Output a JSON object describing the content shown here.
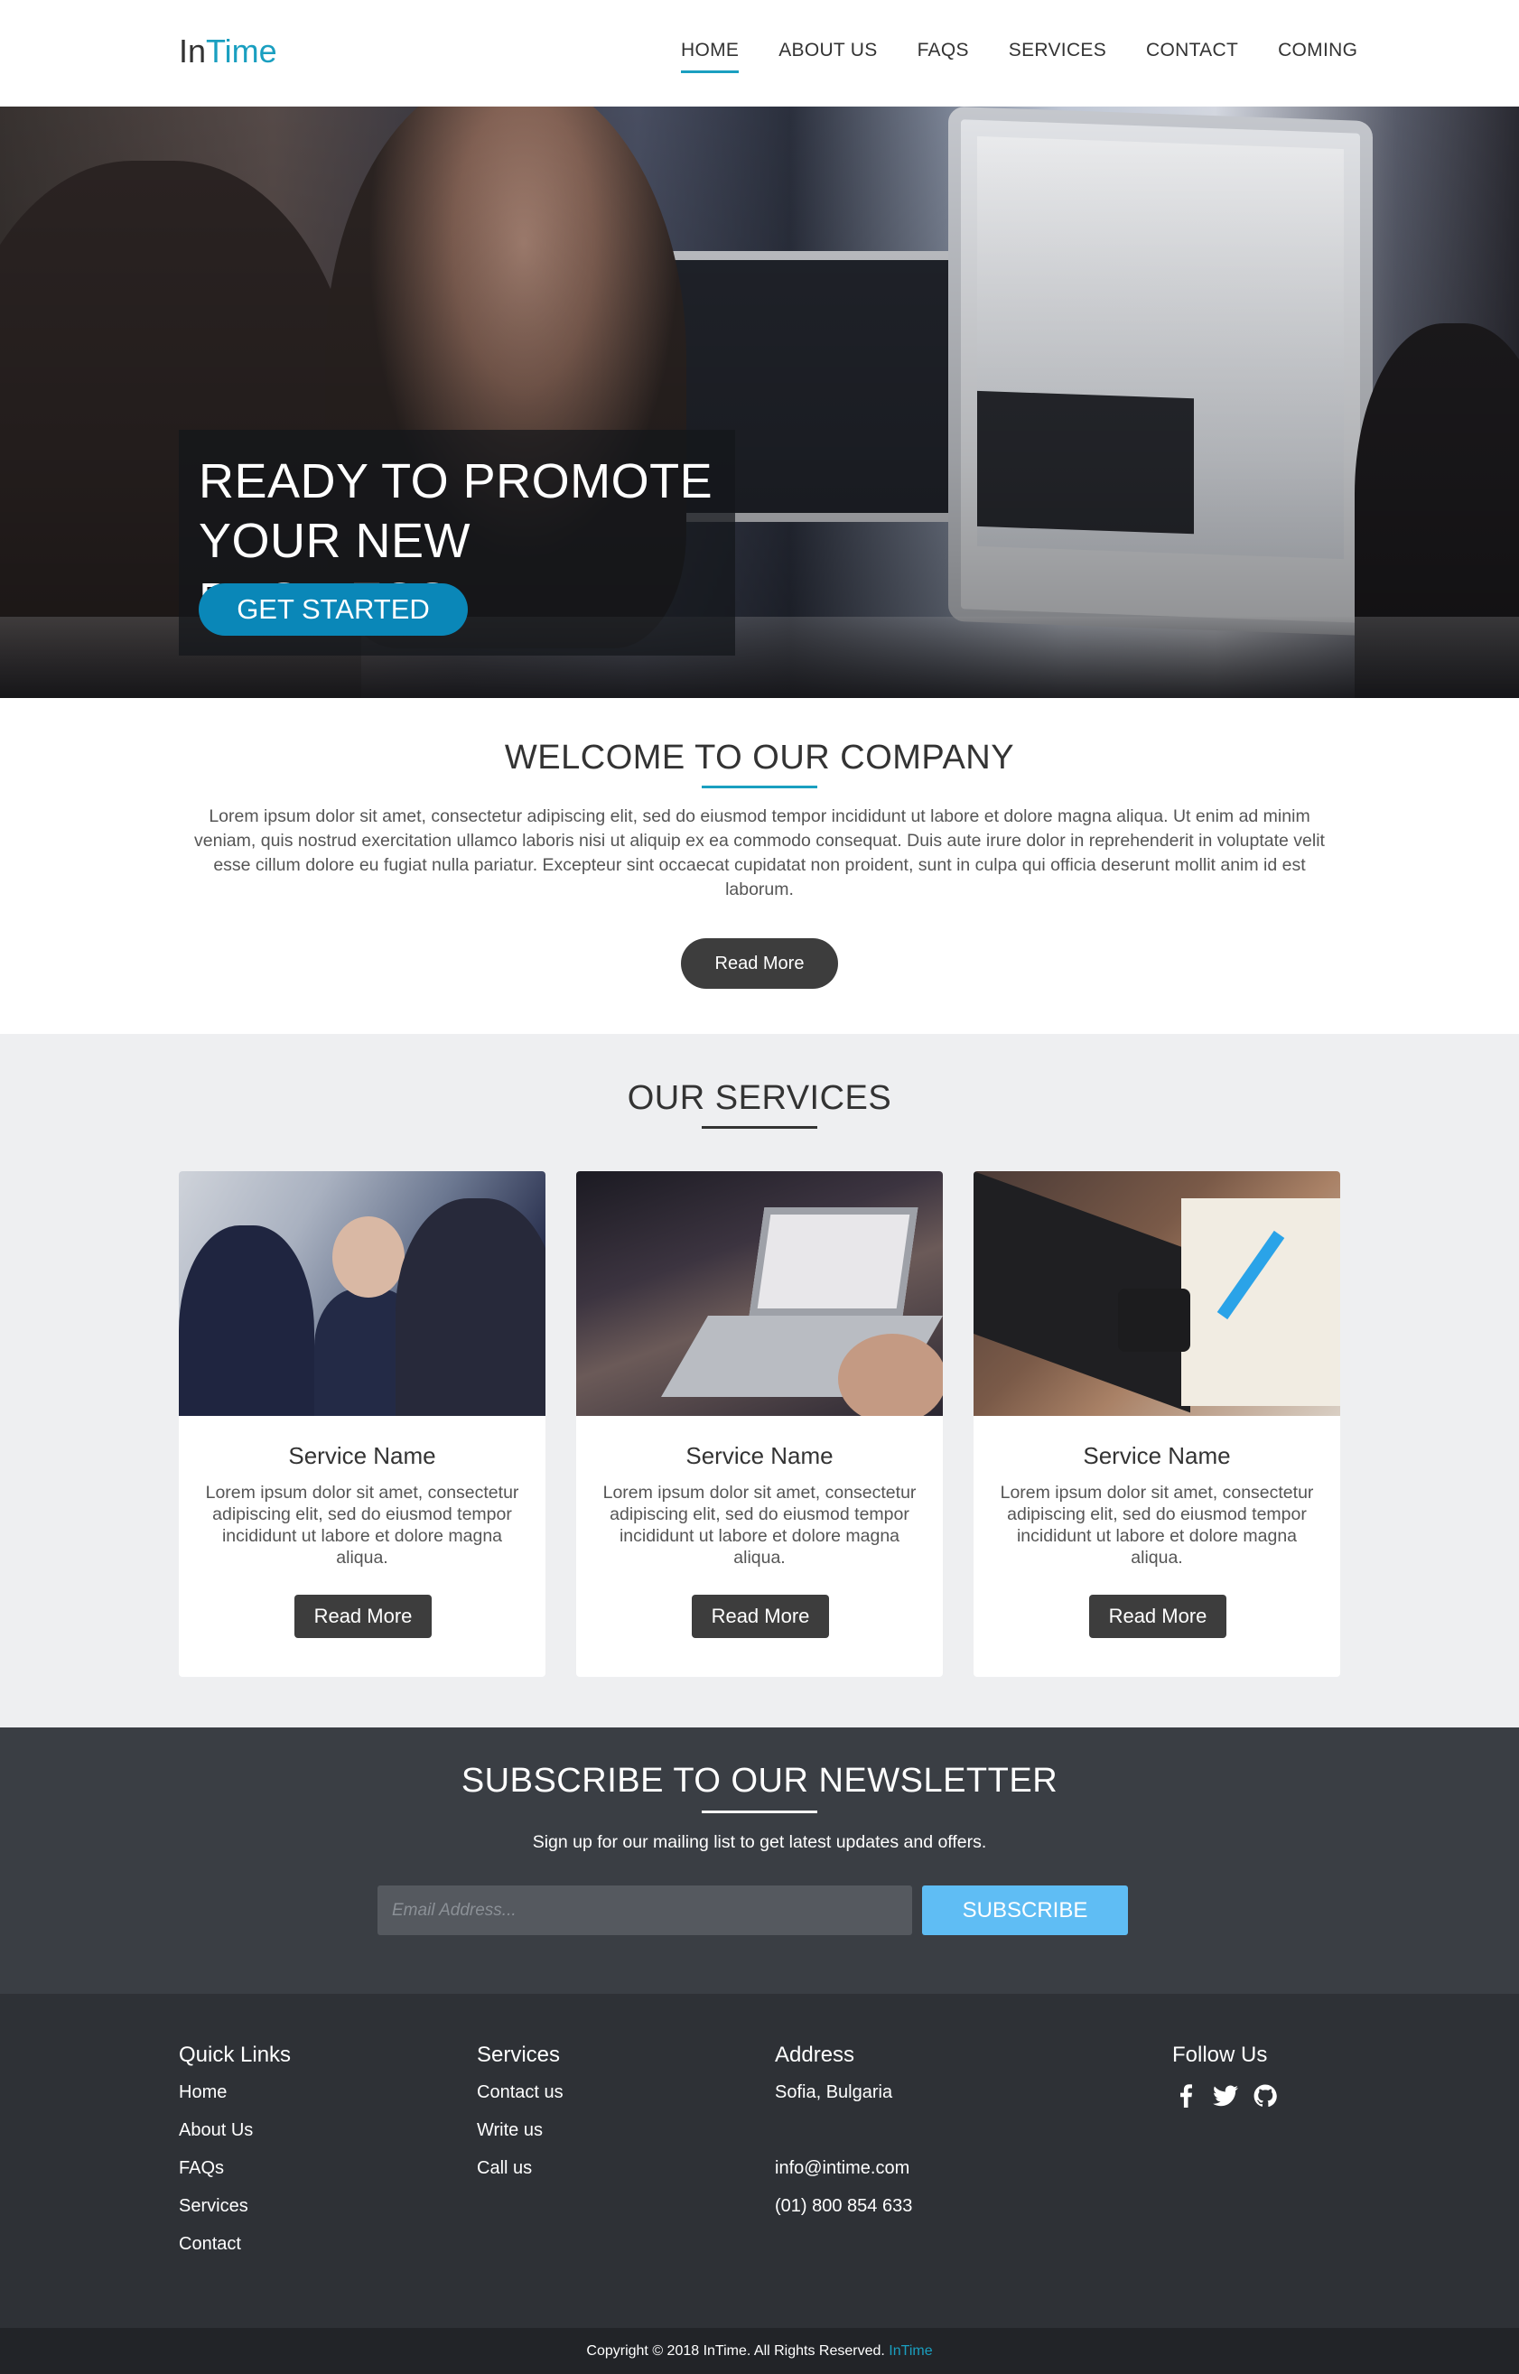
{
  "brand": {
    "part1": "In",
    "part2": "Time"
  },
  "nav": {
    "items": [
      {
        "label": "HOME"
      },
      {
        "label": "ABOUT US"
      },
      {
        "label": "FAQS"
      },
      {
        "label": "SERVICES"
      },
      {
        "label": "CONTACT"
      },
      {
        "label": "COMING"
      }
    ],
    "active": "HOME"
  },
  "hero": {
    "title_line1": "READY TO PROMOTE",
    "title_line2": "YOUR NEW BUSINESS",
    "cta_label": "GET STARTED"
  },
  "welcome": {
    "title": "WELCOME TO OUR COMPANY",
    "body": "Lorem ipsum dolor sit amet, consectetur adipiscing elit, sed do eiusmod tempor incididunt ut labore et dolore magna aliqua. Ut enim ad minim veniam, quis nostrud exercitation ullamco laboris nisi ut aliquip ex ea commodo consequat. Duis aute irure dolor in reprehenderit in voluptate velit esse cillum dolore eu fugiat nulla pariatur. Excepteur sint occaecat cupidatat non proident, sunt in culpa qui officia deserunt mollit anim id est laborum.",
    "button_label": "Read More"
  },
  "services": {
    "title": "OUR SERVICES",
    "cards": [
      {
        "name": "Service Name",
        "desc": "Lorem ipsum dolor sit amet, consectetur adipiscing elit, sed do eiusmod tempor incididunt ut labore et dolore magna aliqua.",
        "button_label": "Read More"
      },
      {
        "name": "Service Name",
        "desc": "Lorem ipsum dolor sit amet, consectetur adipiscing elit, sed do eiusmod tempor incididunt ut labore et dolore magna aliqua.",
        "button_label": "Read More"
      },
      {
        "name": "Service Name",
        "desc": "Lorem ipsum dolor sit amet, consectetur adipiscing elit, sed do eiusmod tempor incididunt ut labore et dolore magna aliqua.",
        "button_label": "Read More"
      }
    ]
  },
  "newsletter": {
    "title": "SUBSCRIBE TO OUR NEWSLETTER",
    "subtitle": "Sign up for our mailing list to get latest updates and offers.",
    "email_placeholder": "Email Address...",
    "button_label": "SUBSCRIBE"
  },
  "footer": {
    "quick_links": {
      "heading": "Quick Links",
      "items": [
        "Home",
        "About Us",
        "FAQs",
        "Services",
        "Contact"
      ]
    },
    "services": {
      "heading": "Services",
      "items": [
        "Contact us",
        "Write us",
        "Call us"
      ]
    },
    "address": {
      "heading": "Address",
      "city": "Sofia, Bulgaria",
      "email": "info@intime.com",
      "phone": "(01) 800 854 633"
    },
    "follow": {
      "heading": "Follow Us",
      "icons": [
        "facebook-icon",
        "twitter-icon",
        "github-icon"
      ]
    },
    "copyright": "Copyright © 2018 InTime. All Rights Reserved.",
    "copyright_brand": "InTime"
  },
  "colors": {
    "accent": "#1a9fc0",
    "hero_button": "#0a87b8",
    "subscribe_button": "#5fbdf4",
    "dark_button": "#3d3d3d",
    "newsletter_bg": "#3a3e44",
    "footer_bg": "#2e3136"
  }
}
